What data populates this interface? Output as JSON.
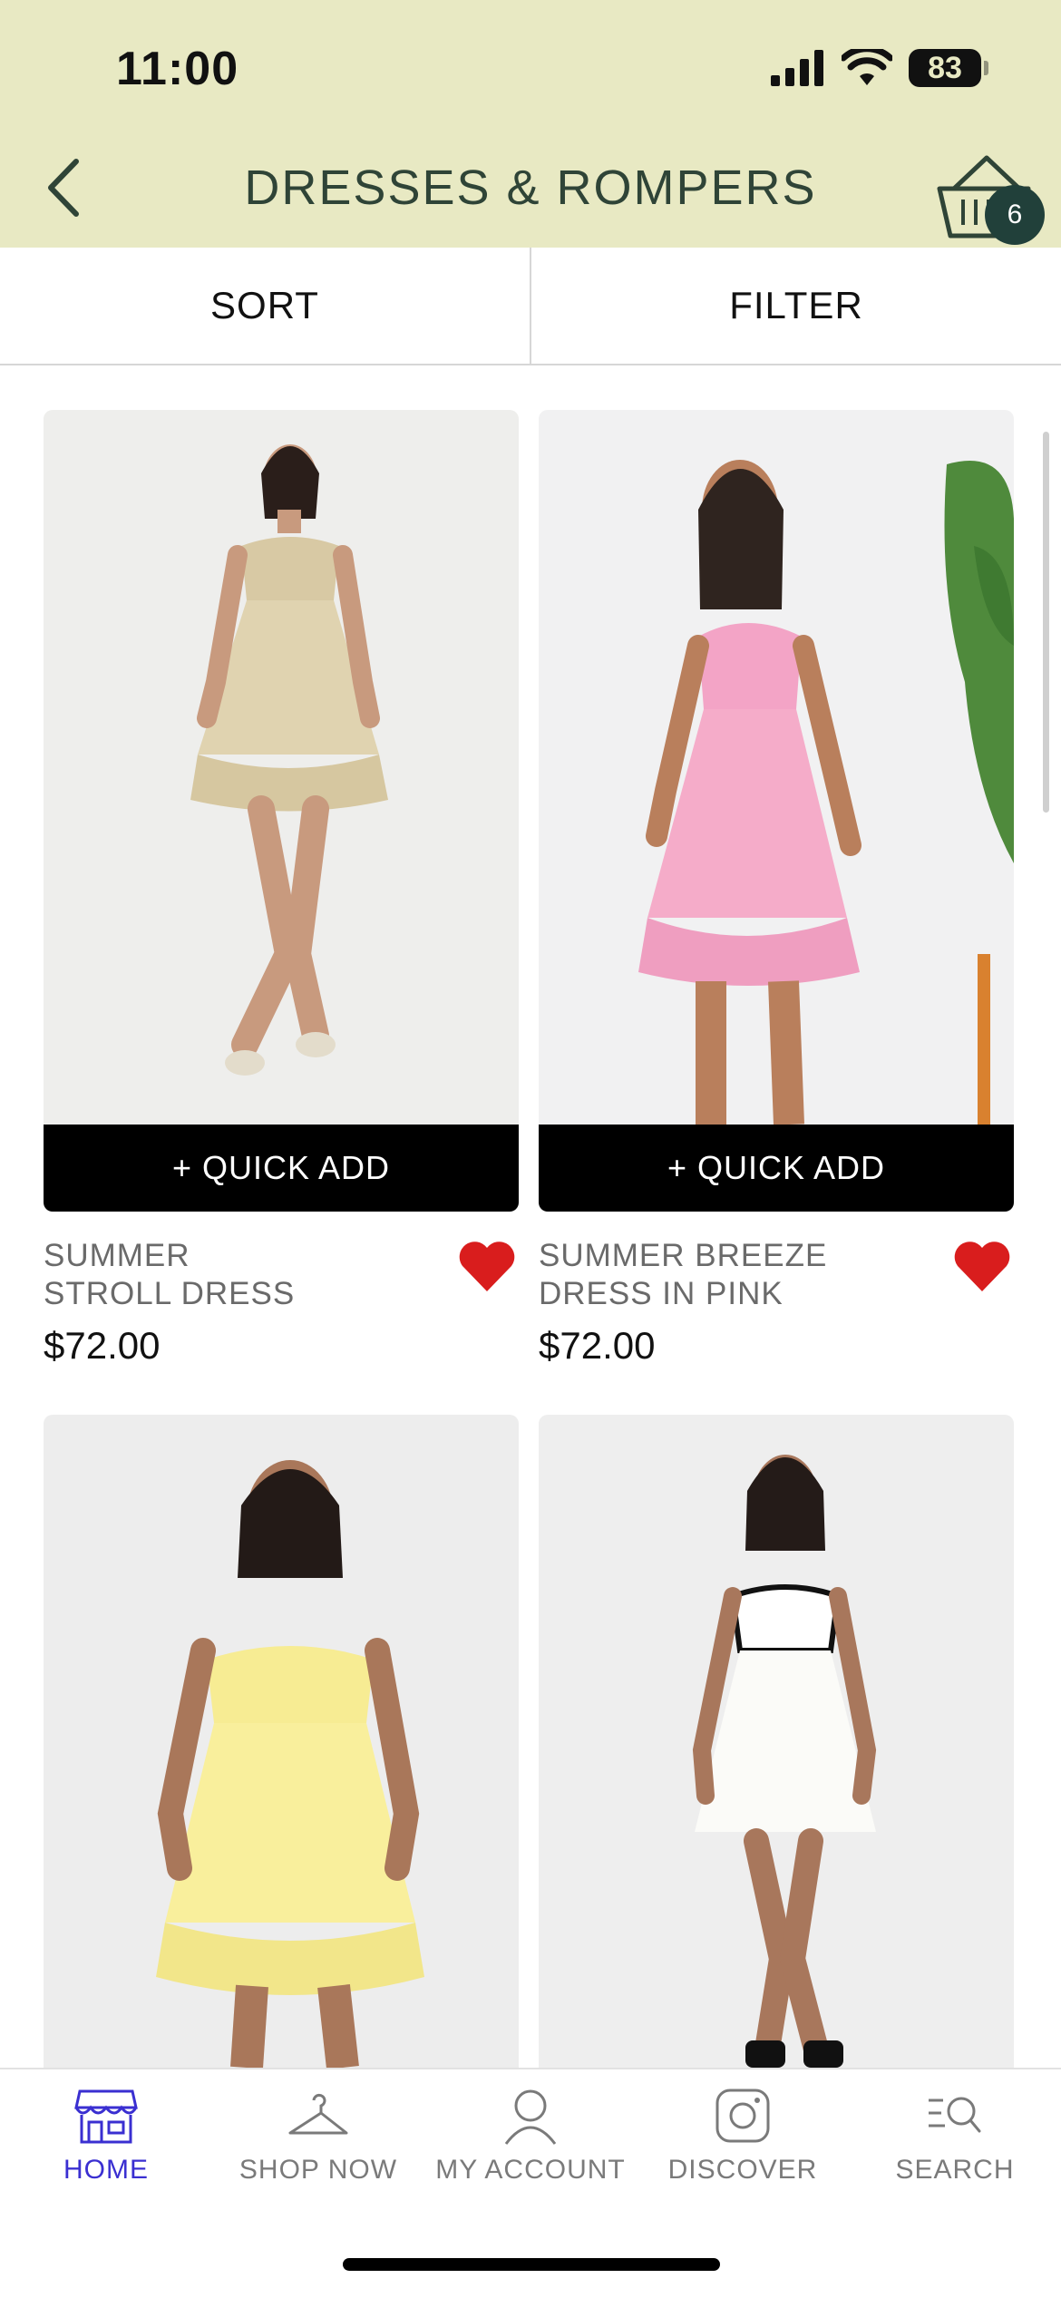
{
  "status_bar": {
    "time": "11:00",
    "battery": "83"
  },
  "header": {
    "title": "DRESSES & ROMPERS",
    "cart_count": "6"
  },
  "toolbar": {
    "sort_label": "SORT",
    "filter_label": "FILTER"
  },
  "products": [
    {
      "name_line1": "SUMMER",
      "name_line2": "STROLL DRESS",
      "price": "$72.00",
      "quick_add": "+ QUICK ADD",
      "favorited": true
    },
    {
      "name_line1": "SUMMER BREEZE",
      "name_line2": "DRESS IN PINK",
      "price": "$72.00",
      "quick_add": "+ QUICK ADD",
      "favorited": true
    },
    {
      "name_line1": "",
      "name_line2": "",
      "price": "",
      "quick_add": "",
      "favorited": false
    },
    {
      "name_line1": "",
      "name_line2": "",
      "price": "",
      "quick_add": "",
      "favorited": false
    }
  ],
  "bottom_nav": {
    "items": [
      {
        "label": "HOME",
        "icon": "storefront-icon",
        "active": true
      },
      {
        "label": "SHOP NOW",
        "icon": "hanger-icon",
        "active": false
      },
      {
        "label": "MY ACCOUNT",
        "icon": "user-icon",
        "active": false
      },
      {
        "label": "DISCOVER",
        "icon": "instagram-icon",
        "active": false
      },
      {
        "label": "SEARCH",
        "icon": "search-list-icon",
        "active": false
      }
    ]
  },
  "colors": {
    "header_bg": "#e8e9c3",
    "title_text": "#2f4437",
    "badge_bg": "#21403a",
    "heart": "#d91d1d",
    "active_nav": "#3a2fd1"
  }
}
